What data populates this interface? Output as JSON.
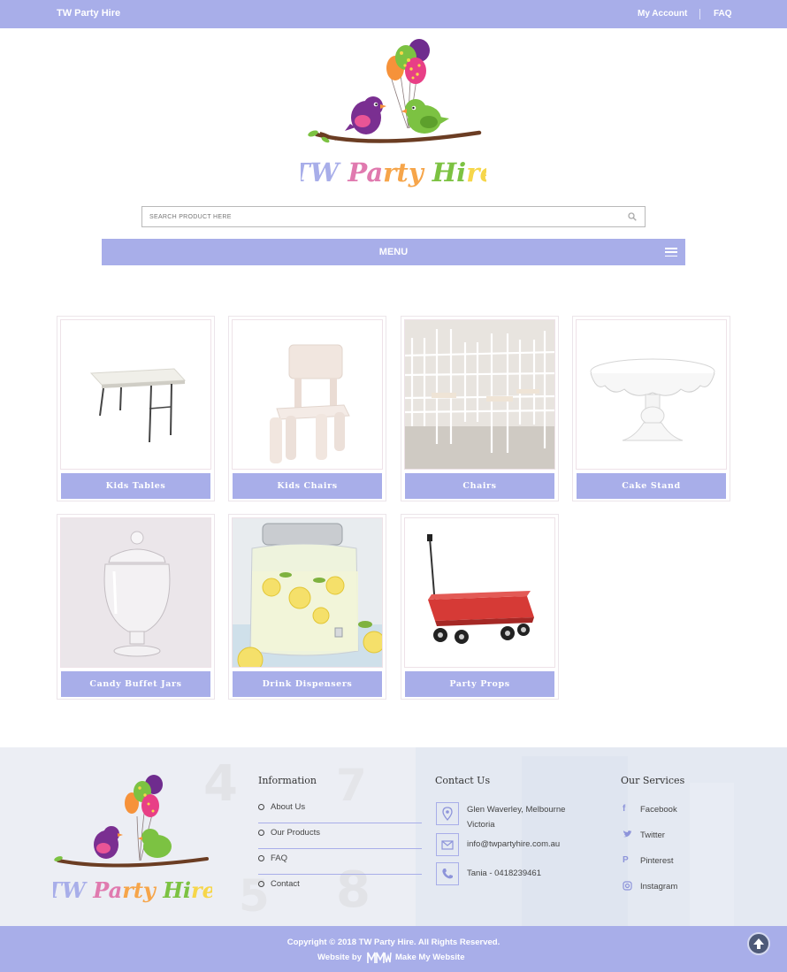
{
  "topbar": {
    "brand": "TW Party Hire",
    "my_account": "My Account",
    "faq": "FAQ"
  },
  "search": {
    "placeholder": "SEARCH PRODUCT HERE"
  },
  "menu": {
    "label": "MENU"
  },
  "categories": [
    {
      "label": "Kids Tables"
    },
    {
      "label": "Kids Chairs"
    },
    {
      "label": "Chairs"
    },
    {
      "label": "Cake Stand"
    },
    {
      "label": "Candy Buffet Jars"
    },
    {
      "label": "Drink Dispensers"
    },
    {
      "label": "Party Props"
    }
  ],
  "footer": {
    "logo_text": "TW Party Hire",
    "information": {
      "title": "Information",
      "items": [
        "About Us",
        "Our Products",
        "FAQ",
        "Contact"
      ]
    },
    "contact": {
      "title": "Contact Us",
      "address_line1": "Glen Waverley, Melbourne",
      "address_line2": "Victoria",
      "email": "info@twpartyhire.com.au",
      "phone": "Tania - 0418239461"
    },
    "services": {
      "title": "Our Services",
      "items": [
        "Facebook",
        "Twitter",
        "Pinterest",
        "Instagram"
      ]
    }
  },
  "bottom": {
    "copyright": "Copyright © 2018 TW Party Hire. All Rights Reserved.",
    "website_by": "Website by",
    "agency": "Make My Website"
  },
  "colors": {
    "accent": "#a8aee9",
    "footer_bg": "#eef0f5",
    "to_top": "#4e5a78"
  }
}
